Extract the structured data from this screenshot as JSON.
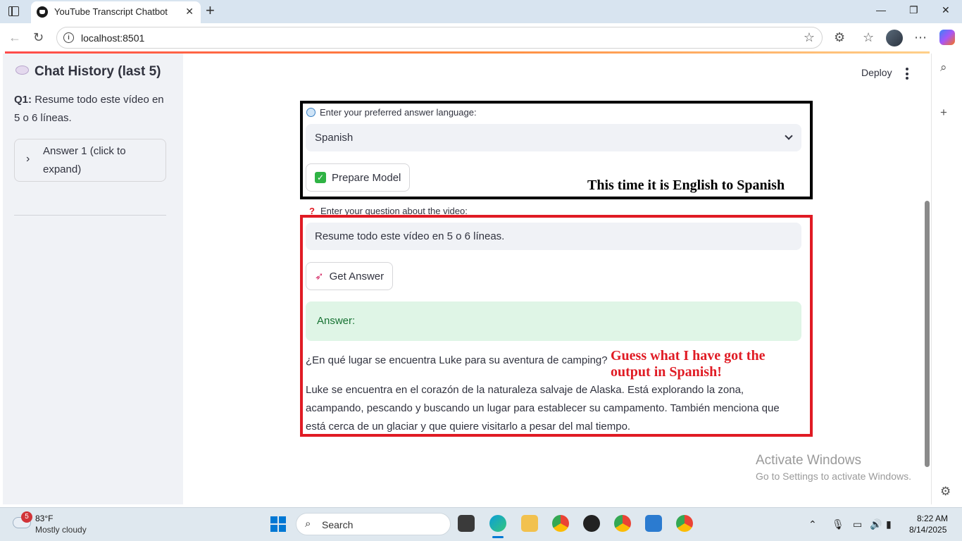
{
  "browser": {
    "tab_title": "YouTube Transcript Chatbot",
    "url": "localhost:8501"
  },
  "sidebar": {
    "history_title": "Chat History (last 5)",
    "q1_label": "Q1:",
    "q1_text": "Resume todo este vídeo en 5 o 6 líneas.",
    "expander_label": "Answer 1 (click to expand)"
  },
  "header": {
    "deploy_label": "Deploy"
  },
  "language": {
    "label": "Enter your preferred answer language:",
    "selected": "Spanish",
    "prepare_button": "Prepare Model"
  },
  "question": {
    "label": "Enter your question about the video:",
    "value": "Resume todo este vídeo en 5 o 6 líneas.",
    "get_answer_button": "Get Answer"
  },
  "answer": {
    "header": "Answer:",
    "question_line": "¿En qué lugar se encuentra Luke para su aventura de camping?",
    "body": "Luke se encuentra en el corazón de la naturaleza salvaje de Alaska. Está explorando la zona, acampando, pescando y buscando un lugar para establecer su campamento. También menciona que está cerca de un glaciar y que quiere visitarlo a pesar del mal tiempo."
  },
  "annotations": {
    "black_box_note": "This time it is English to Spanish",
    "red_box_note": "Guess what I have got the output in Spanish!"
  },
  "watermark": {
    "line1": "Activate Windows",
    "line2": "Go to Settings to activate Windows."
  },
  "taskbar": {
    "weather_badge": "5",
    "temperature": "83°F",
    "condition": "Mostly cloudy",
    "search_placeholder": "Search",
    "time": "8:22 AM",
    "date": "8/14/2025"
  },
  "colors": {
    "accent_red": "#e01b24",
    "success_bg": "#dff5e6",
    "input_bg": "#f0f2f6"
  }
}
